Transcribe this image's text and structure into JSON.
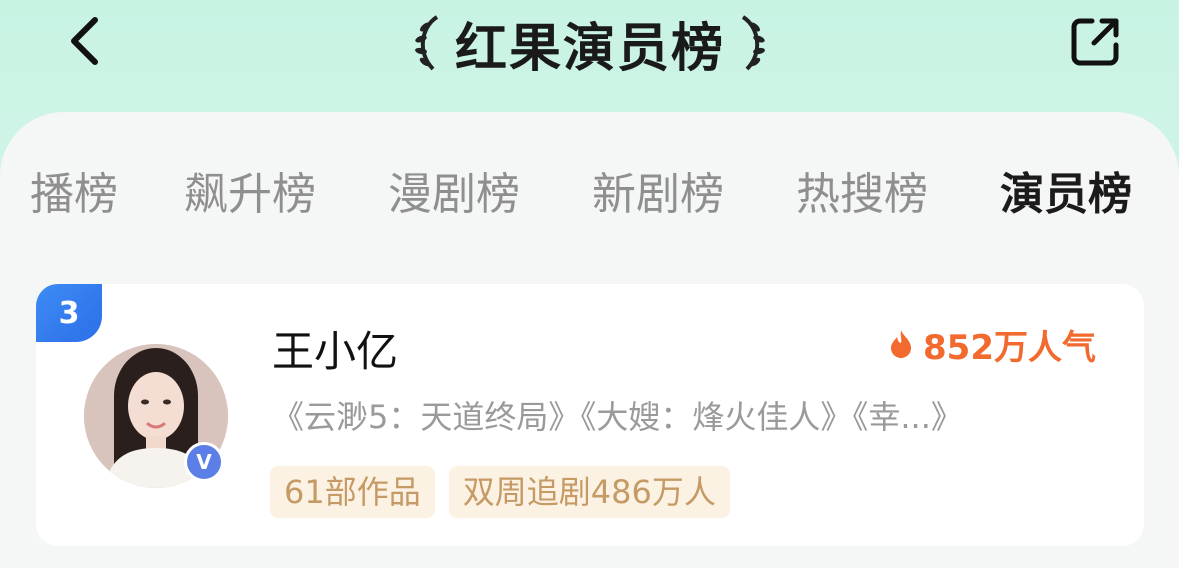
{
  "header": {
    "title": "红果演员榜",
    "back_icon": "chevron-left-icon",
    "share_icon": "share-icon"
  },
  "tabs": [
    {
      "label": "播榜",
      "active": false
    },
    {
      "label": "飙升榜",
      "active": false
    },
    {
      "label": "漫剧榜",
      "active": false
    },
    {
      "label": "新剧榜",
      "active": false
    },
    {
      "label": "热搜榜",
      "active": false
    },
    {
      "label": "演员榜",
      "active": true
    }
  ],
  "card": {
    "rank": "3",
    "name": "王小亿",
    "verified_mark": "V",
    "popularity": "852万人气",
    "works": "《云渺5：天道终局》《大嫂：烽火佳人》《幸...》",
    "tags": [
      "61部作品",
      "双周追剧486万人"
    ]
  },
  "colors": {
    "accent_orange": "#f26a2e",
    "rank_blue": "#2c6fe8",
    "tag_text": "#c59a64",
    "tag_bg": "#fbf2e4"
  }
}
